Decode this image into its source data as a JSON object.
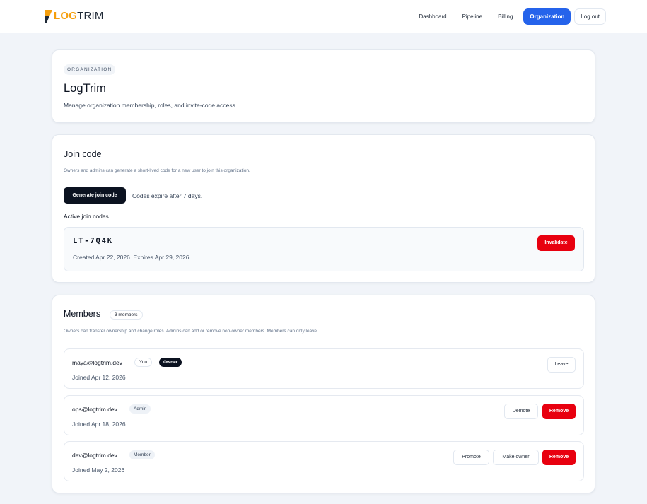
{
  "header": {
    "logo_strong": "LOG",
    "logo_rest": "TRIM",
    "nav": [
      "Dashboard",
      "Pipeline",
      "Billing",
      "Organization"
    ],
    "active_nav": "Organization",
    "logout": "Log out"
  },
  "org": {
    "eyebrow": "ORGANIZATION",
    "name": "LogTrim",
    "description": "Manage organization membership, roles, and invite-code access."
  },
  "join": {
    "title": "Join code",
    "description": "Owners and admins can generate a short-lived code for a new user to join this organization.",
    "generate_label": "Generate join code",
    "expire_note": "Codes expire after 7 days.",
    "active_label": "Active join codes",
    "codes": [
      {
        "code": "LT-7Q4K",
        "meta": "Created Apr 22, 2026. Expires Apr 29, 2026.",
        "action": "Invalidate"
      }
    ]
  },
  "members": {
    "title": "Members",
    "count": "3 members",
    "description": "Owners can transfer ownership and change roles. Admins can add or remove non-owner members. Members can only leave.",
    "items": [
      {
        "email": "maya@logtrim.dev",
        "you": "You",
        "role": "Owner",
        "joined": "Joined Apr 12, 2026",
        "actions": [
          "Leave"
        ]
      },
      {
        "email": "ops@logtrim.dev",
        "role": "Admin",
        "joined": "Joined Apr 18, 2026",
        "actions": [
          "Demote",
          "Remove"
        ]
      },
      {
        "email": "dev@logtrim.dev",
        "role": "Member",
        "joined": "Joined May 2, 2026",
        "actions": [
          "Promote",
          "Make owner",
          "Remove"
        ]
      }
    ]
  },
  "colors": {
    "accent": "#2563eb",
    "danger": "#e8000f",
    "dark": "#0b1220",
    "brand": "#f59e0b"
  }
}
